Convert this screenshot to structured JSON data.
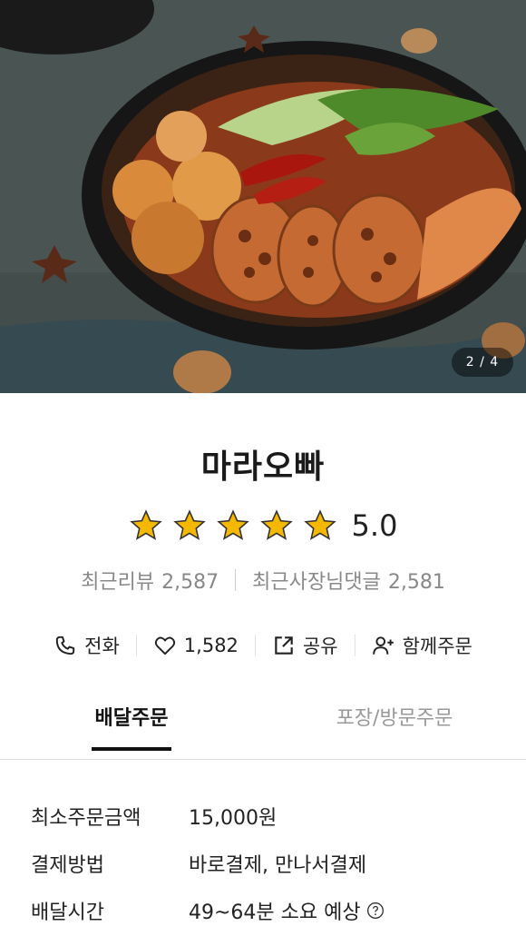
{
  "hero": {
    "counter": "2 / 4"
  },
  "store": {
    "name": "마라오빠",
    "rating": 5.0,
    "rating_text": "5.0",
    "stars_filled": 5,
    "reviews_label": "최근리뷰",
    "reviews_count": "2,587",
    "owner_replies_label": "최근사장님댓글",
    "owner_replies_count": "2,581"
  },
  "actions": {
    "call_label": "전화",
    "like_count": "1,582",
    "share_label": "공유",
    "group_order_label": "함께주문"
  },
  "tabs": [
    {
      "label": "배달주문",
      "active": true
    },
    {
      "label": "포장/방문주문",
      "active": false
    }
  ],
  "info": {
    "min_order_label": "최소주문금액",
    "min_order_value": "15,000원",
    "payment_label": "결제방법",
    "payment_value": "바로결제, 만나서결제",
    "delivery_time_label": "배달시간",
    "delivery_time_value": "49~64분 소요 예상"
  },
  "colors": {
    "star": "#f5b800",
    "accent": "#111111"
  },
  "icons": [
    "phone-icon",
    "heart-icon",
    "share-icon",
    "add-person-icon",
    "help-icon",
    "star-icon"
  ]
}
